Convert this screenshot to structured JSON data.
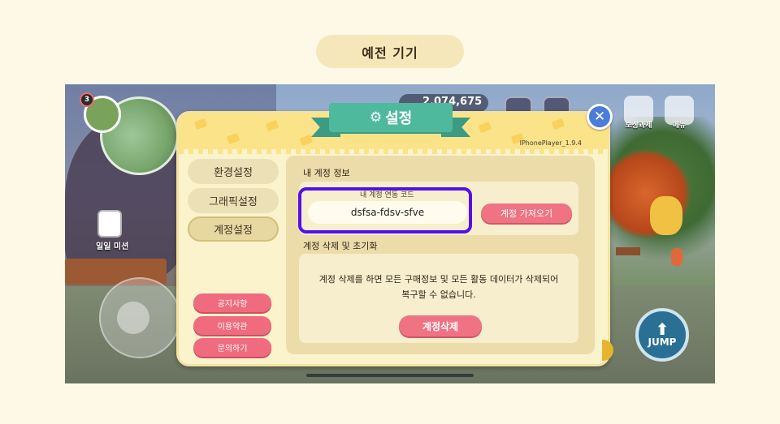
{
  "caption": "예전 기기",
  "hud": {
    "level": "3",
    "coins": "2,074,675",
    "mission_label": "일일 미션",
    "right_buttons": [
      "보상과제",
      "메뉴"
    ],
    "jump_label": "JUMP"
  },
  "dialog": {
    "title": "설정",
    "version": "IPhonePlayer_1.9.4",
    "close_symbol": "✕",
    "side_tabs": [
      "환경설정",
      "그래픽설정",
      "계정설정"
    ],
    "active_tab": "계정설정",
    "side_buttons": [
      "공지사항",
      "이용약관",
      "문의하기"
    ],
    "account": {
      "section_title": "내 계정 정보",
      "code_caption": "내 계정 연동 코드",
      "code_value": "dsfsa-fdsv-sfve",
      "fetch_button": "계정 가져오기"
    },
    "delete": {
      "section_title": "계정 삭제 및 초기화",
      "warning_line1": "계정 삭제를 하면 모든 구매정보 및 모든 활동 데이터가 삭제되어",
      "warning_line2": "복구할 수 없습니다.",
      "delete_button": "계정삭제"
    }
  },
  "colors": {
    "highlight": "#5510e8",
    "ribbon": "#4fb99e",
    "pink": "#f07383",
    "close": "#4b7cd8"
  }
}
